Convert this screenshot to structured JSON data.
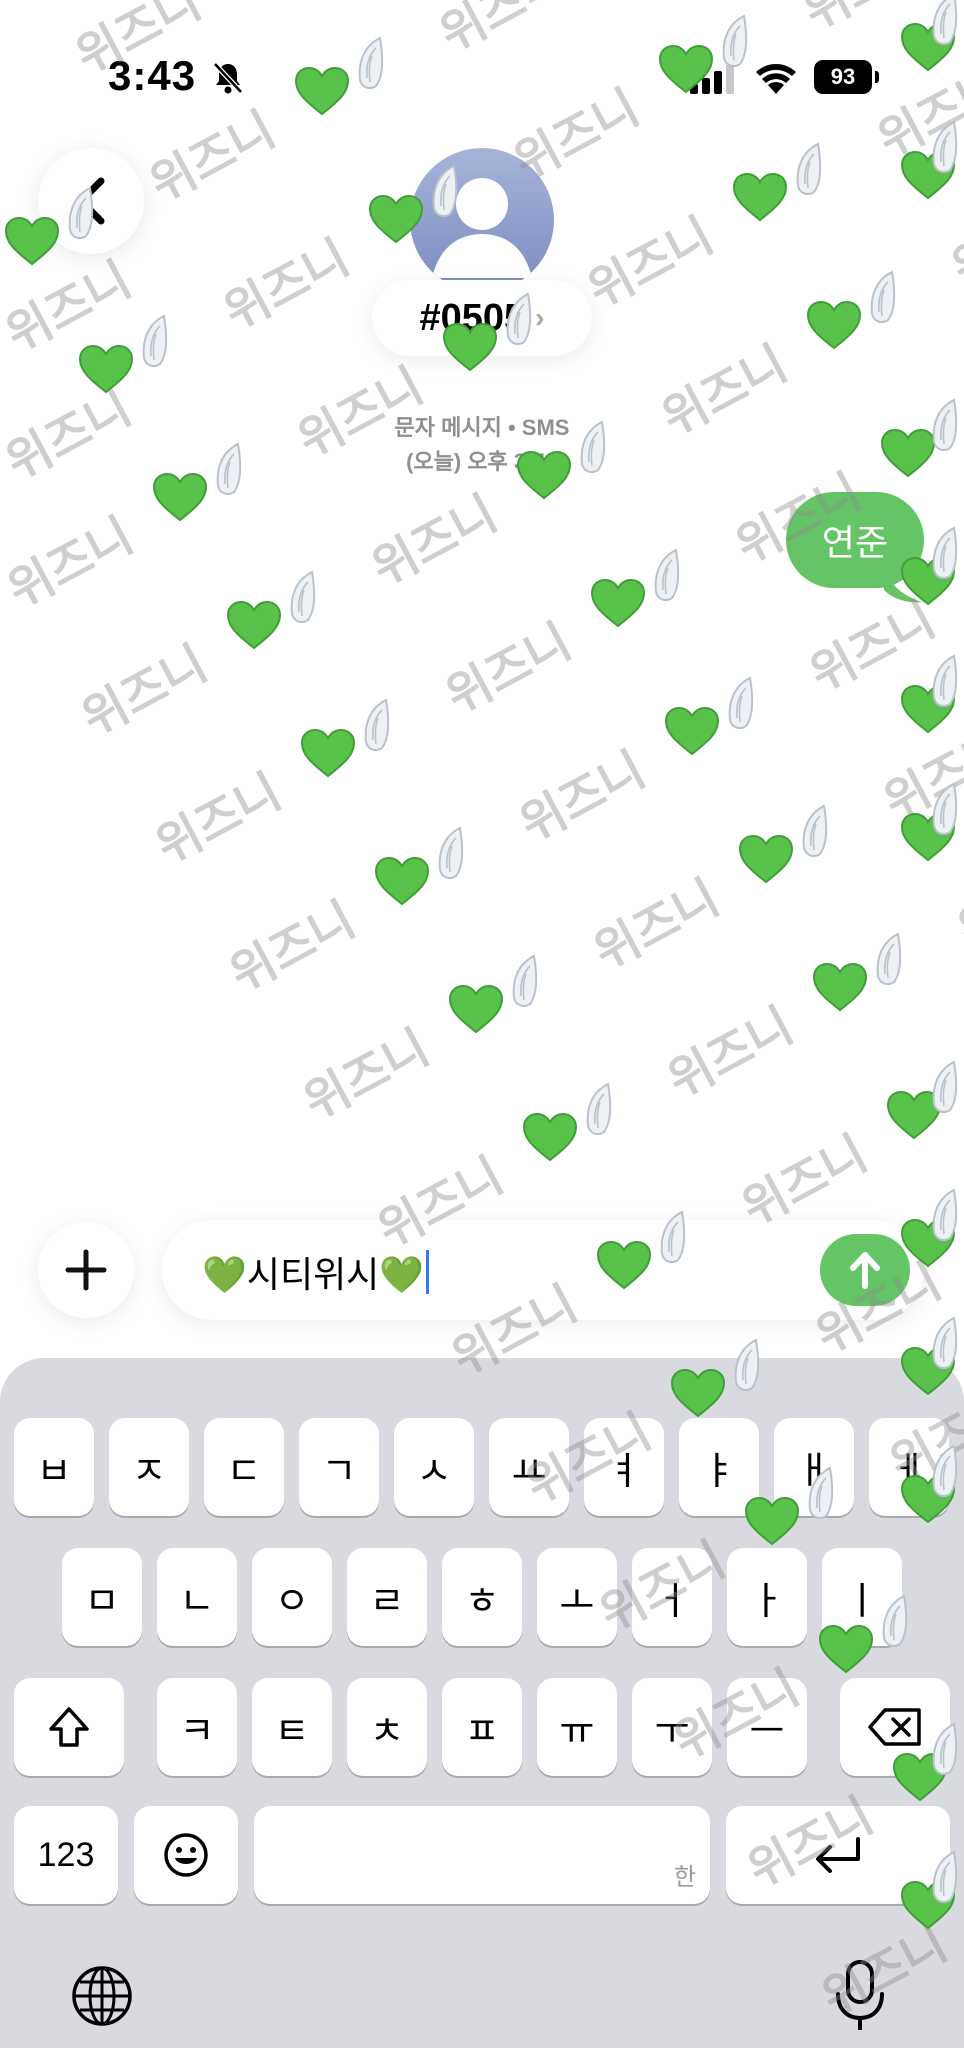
{
  "status_bar": {
    "time": "3:43",
    "battery": "93"
  },
  "header": {
    "contact_name": "#0505",
    "contact_chevron": "›",
    "service_label": "문자 메시지 • SMS",
    "timestamp": "(오늘) 오후 3:43"
  },
  "messages": [
    {
      "text": "연준",
      "sender": "me"
    }
  ],
  "composer": {
    "text": "💚시티위시💚"
  },
  "keyboard": {
    "row1": [
      "ㅂ",
      "ㅈ",
      "ㄷ",
      "ㄱ",
      "ㅅ",
      "ㅛ",
      "ㅕ",
      "ㅑ",
      "ㅐ",
      "ㅔ"
    ],
    "row2": [
      "ㅁ",
      "ㄴ",
      "ㅇ",
      "ㄹ",
      "ㅎ",
      "ㅗ",
      "ㅓ",
      "ㅏ",
      "ㅣ"
    ],
    "row3": [
      "ㅋ",
      "ㅌ",
      "ㅊ",
      "ㅍ",
      "ㅠ",
      "ㅜ",
      "ㅡ"
    ],
    "numbers_key": "123",
    "space_hint": "한"
  },
  "watermark": {
    "text": "위즈니"
  },
  "icons": {
    "back": "chevron-left-icon",
    "bell_off": "bell-slash-icon",
    "signal": "signal-icon",
    "wifi": "wifi-icon",
    "plus": "plus-icon",
    "send": "arrow-up-icon",
    "shift": "shift-icon",
    "delete": "delete-icon",
    "emoji": "emoji-icon",
    "return": "return-icon",
    "globe": "globe-icon",
    "mic": "microphone-icon"
  },
  "colors": {
    "bubble": "#65c466",
    "caret": "#3478f6",
    "keyboard_bg": "#d8dadf"
  }
}
